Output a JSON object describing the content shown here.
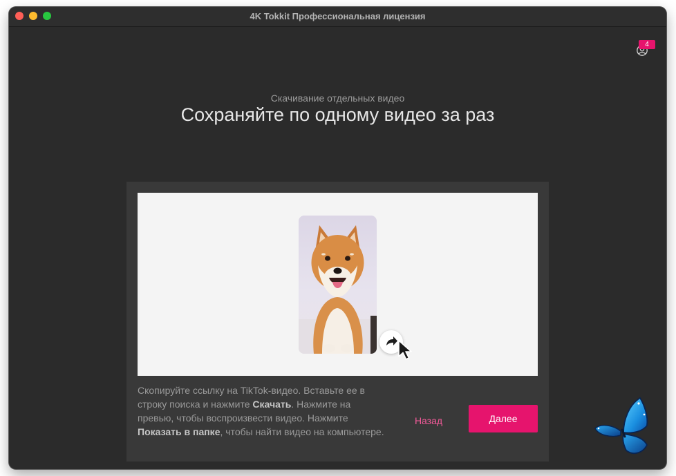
{
  "window": {
    "title": "4K Tokkit Профессиональная лицензия"
  },
  "header": {
    "account_icon": "user-circle-icon",
    "badge_count": "4"
  },
  "intro": {
    "subtitle": "Скачивание отдельных видео",
    "heading": "Сохраняйте по одному видео за раз"
  },
  "preview": {
    "image": "shiba-inu-dog-photo",
    "share_icon": "share-arrow-icon",
    "cursor_icon": "mouse-pointer-icon"
  },
  "instructions": {
    "part1": "Скопируйте ссылку на TikTok-видео. Вставьте ее в строку поиска и нажмите ",
    "bold1": "Скачать",
    "part2": ". Нажмите на превью, чтобы воспроизвести видео. Нажмите ",
    "bold2": "Показать в папке",
    "part3": ", чтобы найти видео на компьютере."
  },
  "actions": {
    "back_label": "Назад",
    "next_label": "Далее"
  },
  "decor": {
    "mascot": "blue-butterfly-icon"
  },
  "colors": {
    "accent": "#e6146d",
    "background": "#2b2b2b",
    "panel": "#393939",
    "link": "#f45a9a"
  }
}
